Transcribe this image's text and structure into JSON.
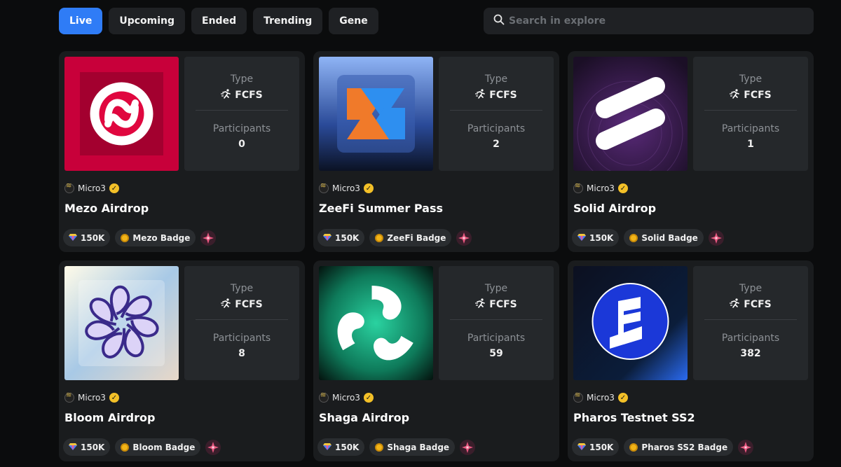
{
  "tabs": [
    {
      "label": "Live",
      "active": true
    },
    {
      "label": "Upcoming",
      "active": false
    },
    {
      "label": "Ended",
      "active": false
    },
    {
      "label": "Trending",
      "active": false
    },
    {
      "label": "Gene",
      "active": false
    }
  ],
  "search": {
    "placeholder": "Search in explore"
  },
  "labels": {
    "type": "Type",
    "participants": "Participants"
  },
  "cards": [
    {
      "title": "Mezo Airdrop",
      "creator": "Micro3",
      "type": "FCFS",
      "participants": "0",
      "points": "150K",
      "badge": "Mezo Badge",
      "logo": "mezo-logo"
    },
    {
      "title": "ZeeFi Summer Pass",
      "creator": "Micro3",
      "type": "FCFS",
      "participants": "2",
      "points": "150K",
      "badge": "ZeeFi Badge",
      "logo": "zeefi-logo"
    },
    {
      "title": "Solid Airdrop",
      "creator": "Micro3",
      "type": "FCFS",
      "participants": "1",
      "points": "150K",
      "badge": "Solid Badge",
      "logo": "solid-logo"
    },
    {
      "title": "Bloom Airdrop",
      "creator": "Micro3",
      "type": "FCFS",
      "participants": "8",
      "points": "150K",
      "badge": "Bloom Badge",
      "logo": "bloom-logo"
    },
    {
      "title": "Shaga Airdrop",
      "creator": "Micro3",
      "type": "FCFS",
      "participants": "59",
      "points": "150K",
      "badge": "Shaga Badge",
      "logo": "shaga-logo"
    },
    {
      "title": "Pharos Testnet SS2",
      "creator": "Micro3",
      "type": "FCFS",
      "participants": "382",
      "points": "150K",
      "badge": "Pharos SS2 Badge",
      "logo": "pharos-logo"
    }
  ],
  "colors": {
    "accent": "#2f7cf6",
    "card": "#1a1c1e",
    "panel": "#25282b",
    "verified": "#f3c028"
  }
}
